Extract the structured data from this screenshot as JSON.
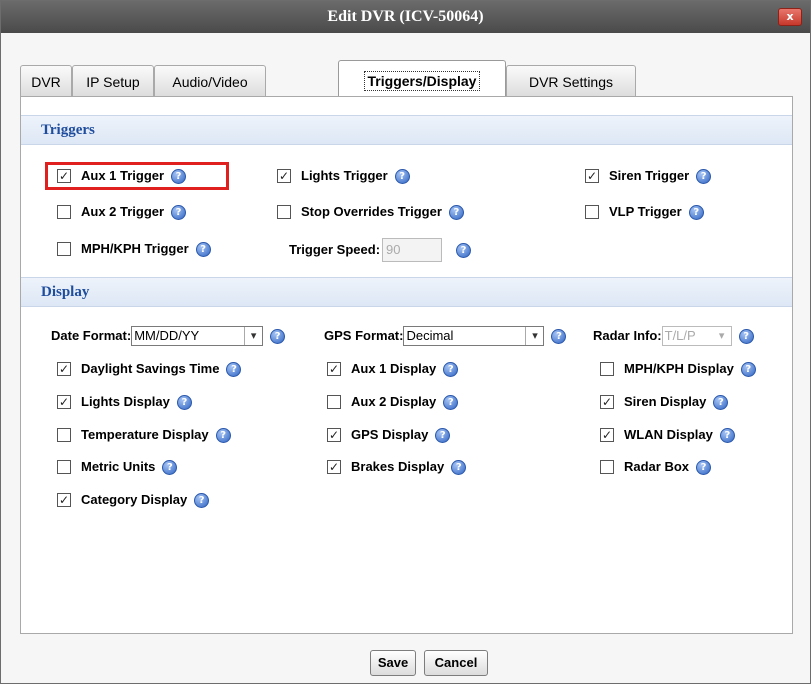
{
  "dialog": {
    "title": "Edit DVR (ICV-50064)",
    "close_glyph": "x"
  },
  "tabs": [
    {
      "label": "DVR",
      "active": false
    },
    {
      "label": "IP Setup",
      "active": false
    },
    {
      "label": "Audio/Video",
      "active": false
    },
    {
      "label": "Triggers/Display",
      "active": true
    },
    {
      "label": "DVR Settings",
      "active": false
    }
  ],
  "triggers": {
    "header": "Triggers",
    "aux1": {
      "label": "Aux 1 Trigger",
      "checked": true
    },
    "lights": {
      "label": "Lights Trigger",
      "checked": true
    },
    "siren": {
      "label": "Siren Trigger",
      "checked": true
    },
    "aux2": {
      "label": "Aux 2 Trigger",
      "checked": false
    },
    "stop_overrides": {
      "label": "Stop Overrides Trigger",
      "checked": false
    },
    "vlp": {
      "label": "VLP Trigger",
      "checked": false
    },
    "mph_kph": {
      "label": "MPH/KPH Trigger",
      "checked": false
    },
    "trigger_speed": {
      "label": "Trigger Speed:",
      "value": "90"
    }
  },
  "display": {
    "header": "Display",
    "date_format": {
      "label": "Date Format:",
      "value": "MM/DD/YY"
    },
    "gps_format": {
      "label": "GPS Format:",
      "value": "Decimal"
    },
    "radar_info": {
      "label": "Radar Info:",
      "value": "T/L/P"
    },
    "daylight_savings": {
      "label": "Daylight Savings Time",
      "checked": true
    },
    "aux1_display": {
      "label": "Aux 1 Display",
      "checked": true
    },
    "mph_kph_display": {
      "label": "MPH/KPH Display",
      "checked": false
    },
    "lights_display": {
      "label": "Lights Display",
      "checked": true
    },
    "aux2_display": {
      "label": "Aux 2 Display",
      "checked": false
    },
    "siren_display": {
      "label": "Siren Display",
      "checked": true
    },
    "temperature_display": {
      "label": "Temperature Display",
      "checked": false
    },
    "gps_display": {
      "label": "GPS Display",
      "checked": true
    },
    "wlan_display": {
      "label": "WLAN Display",
      "checked": true
    },
    "metric_units": {
      "label": "Metric Units",
      "checked": false
    },
    "brakes_display": {
      "label": "Brakes Display",
      "checked": true
    },
    "radar_box": {
      "label": "Radar Box",
      "checked": false
    },
    "category_display": {
      "label": "Category Display",
      "checked": true
    }
  },
  "footer": {
    "save_label": "Save",
    "cancel_label": "Cancel"
  },
  "icons": {
    "help": "help-icon",
    "checkmark": "✓",
    "dropdown": "▾"
  },
  "colors": {
    "section_header_text": "#1f4d9e",
    "highlight_border": "#e01f1f",
    "help_icon": "#2f64c2"
  }
}
